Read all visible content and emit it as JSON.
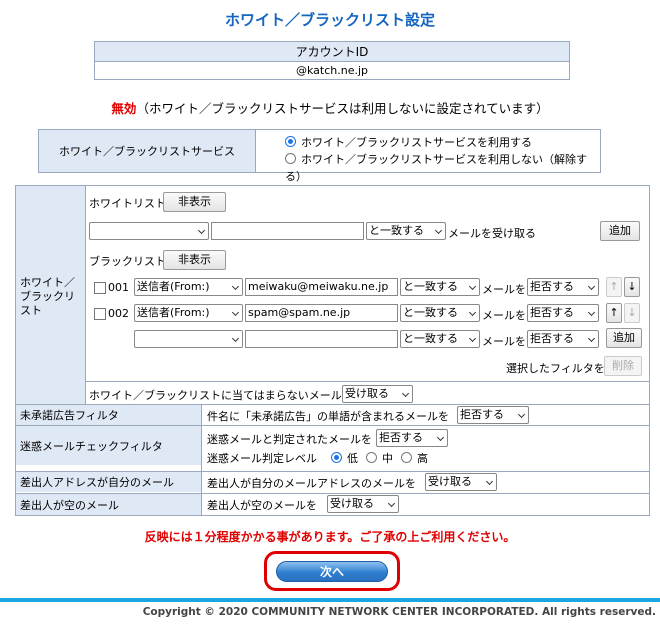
{
  "page_title": "ホワイト／ブラックリスト設定",
  "account": {
    "header": "アカウントID",
    "value": "@katch.ne.jp"
  },
  "status": {
    "state": "無効",
    "message": "（ホワイト／ブラックリストサービスは利用しないに設定されています）"
  },
  "service": {
    "label": "ホワイト／ブラックリストサービス",
    "option_use": "ホワイト／ブラックリストサービスを利用する",
    "option_not_use": "ホワイト／ブラックリストサービスを利用しない（解除する）",
    "selected": "use"
  },
  "wblist": {
    "section_label": "ホワイト／ブラックリスト",
    "whitelist": {
      "title": "ホワイトリスト",
      "hide_button": "非表示",
      "field_select": "",
      "input_value": "",
      "match_select": "と一致する",
      "action_text": "メールを受け取る",
      "add_button": "追加"
    },
    "blacklist": {
      "title": "ブラックリスト",
      "hide_button": "非表示",
      "rows": [
        {
          "id": "001",
          "field": "送信者(From:)",
          "value": "meiwaku@meiwaku.ne.jp",
          "match": "と一致する",
          "mail_label": "メールを",
          "action": "拒否する"
        },
        {
          "id": "002",
          "field": "送信者(From:)",
          "value": "spam@spam.ne.jp",
          "match": "と一致する",
          "mail_label": "メールを",
          "action": "拒否する"
        }
      ],
      "new_row": {
        "field": "",
        "value": "",
        "match": "と一致する",
        "mail_label": "メールを",
        "action": "拒否する"
      },
      "up_arrow": "↑",
      "down_arrow": "↓",
      "add_button": "追加",
      "selected_filter_label": "選択したフィルタを",
      "delete_button": "削除"
    },
    "other_mail": {
      "label": "ホワイト／ブラックリストに当てはまらないメールを",
      "action": "受け取る"
    }
  },
  "filters": [
    {
      "label": "未承諾広告フィルタ",
      "text": "件名に「未承諾広告」の単語が含まれるメールを",
      "action": "拒否する"
    },
    {
      "label": "迷惑メールチェックフィルタ",
      "text": "迷惑メールと判定されたメールを",
      "action": "拒否する",
      "level_label": "迷惑メール判定レベル",
      "levels": [
        "低",
        "中",
        "高"
      ],
      "selected_level": "低"
    },
    {
      "label": "差出人アドレスが自分のメール",
      "text": "差出人が自分のメールアドレスのメールを",
      "action": "受け取る"
    },
    {
      "label": "差出人が空のメール",
      "text": "差出人が空のメールを",
      "action": "受け取る"
    }
  ],
  "notice": "反映には１分程度かかる事があります。ご了承の上ご利用ください。",
  "next_button": "次へ",
  "copyright": "Copyright © 2020 COMMUNITY NETWORK CENTER INCORPORATED. All rights reserved.",
  "colors": {
    "title_blue": "#1565c0",
    "warning_red": "#e00000",
    "label_bg": "#dfe8f5",
    "footer_bar": "#1aa6e0"
  }
}
